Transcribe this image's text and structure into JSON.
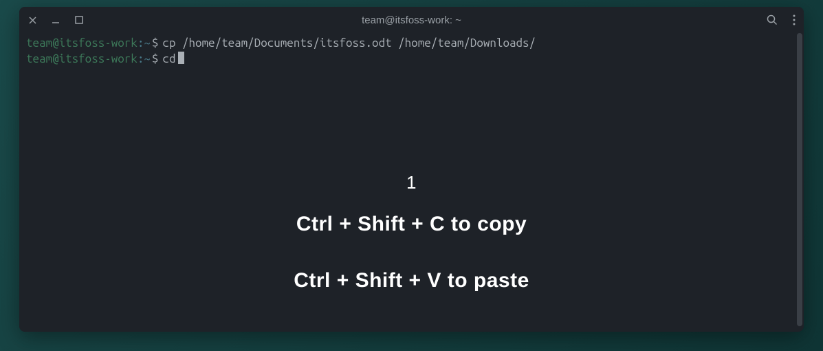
{
  "titlebar": {
    "title": "team@itsfoss-work: ~"
  },
  "terminal": {
    "lines": [
      {
        "user": "team@itsfoss-work",
        "path": ":~",
        "symbol": "$",
        "command": "cp /home/team/Documents/itsfoss.odt /home/team/Downloads/"
      },
      {
        "user": "team@itsfoss-work",
        "path": ":~",
        "symbol": "$",
        "command": "cd "
      }
    ]
  },
  "overlay": {
    "number": "1",
    "copy_tip": "Ctrl + Shift + C to copy",
    "paste_tip": "Ctrl + Shift + V to paste"
  }
}
